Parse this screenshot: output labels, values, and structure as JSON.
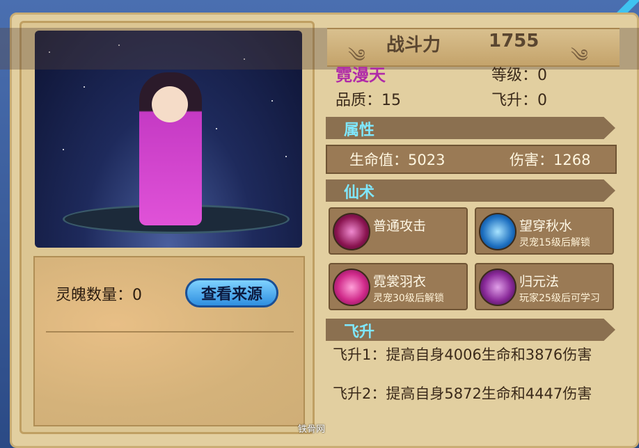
{
  "power": {
    "label": "战斗力",
    "value": "1755"
  },
  "pet": {
    "name": "霓漫天",
    "level_label": "等级：",
    "level": "0",
    "quality_label": "品质：",
    "quality": "15",
    "ascend_label": "飞升：",
    "ascend": "0"
  },
  "soul": {
    "label": "灵魄数量：",
    "count": "0",
    "source_button": "查看来源"
  },
  "sections": {
    "attributes": "属性",
    "skills": "仙术",
    "ascension": "飞升"
  },
  "attributes": {
    "hp_label": "生命值：",
    "hp": "5023",
    "dmg_label": "伤害：",
    "dmg": "1268"
  },
  "skills": [
    {
      "name": "普通攻击",
      "sub": "",
      "icon": "slash-icon"
    },
    {
      "name": "望穿秋水",
      "sub": "灵宠15级后解锁",
      "icon": "water-icon"
    },
    {
      "name": "霓裳羽衣",
      "sub": "灵宠30级后解锁",
      "icon": "swirl-icon"
    },
    {
      "name": "归元法",
      "sub": "玩家25级后可学习",
      "icon": "figure-icon"
    }
  ],
  "ascension_lines": [
    "飞升1：提高自身4006生命和3876伤害",
    "飞升2：提高自身5872生命和4447伤害"
  ],
  "watermark": "铁骨网"
}
